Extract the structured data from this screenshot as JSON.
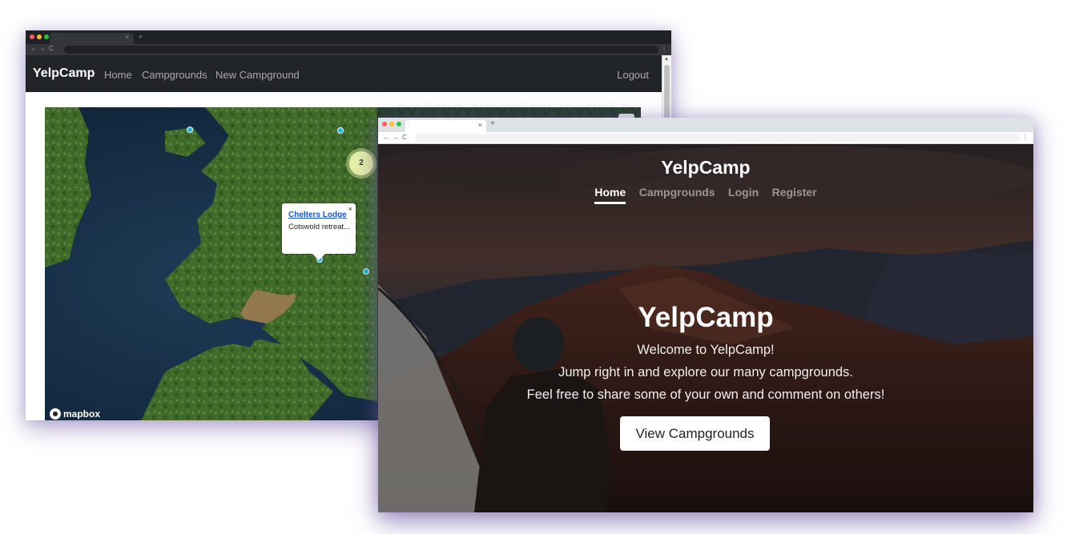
{
  "map_window": {
    "navbar": {
      "brand": "YelpCamp",
      "links": [
        "Home",
        "Campgrounds",
        "New Campground"
      ],
      "logout": "Logout"
    },
    "map": {
      "cluster_count": "2",
      "popup": {
        "title": "Chelters Lodge",
        "description": "Cotswold retreat...",
        "close": "×"
      },
      "attribution": "mapbox"
    }
  },
  "landing_window": {
    "brand": "YelpCamp",
    "nav": [
      "Home",
      "Campgrounds",
      "Login",
      "Register"
    ],
    "active_nav": "Home",
    "hero": {
      "title": "YelpCamp",
      "lines": [
        "Welcome to YelpCamp!",
        "Jump right in and explore our many campgrounds.",
        "Feel free to share some of your own and comment on others!"
      ],
      "button": "View Campgrounds"
    }
  },
  "icons": {
    "tab_close": "×",
    "new_tab": "+",
    "back": "←",
    "forward": "→",
    "reload": "C",
    "menu": "⋮"
  },
  "colors": {
    "navbar_bg": "#212529",
    "marker": "#22b4d4",
    "cluster": "#e6f0a8",
    "popup_link": "#1a56c8"
  }
}
